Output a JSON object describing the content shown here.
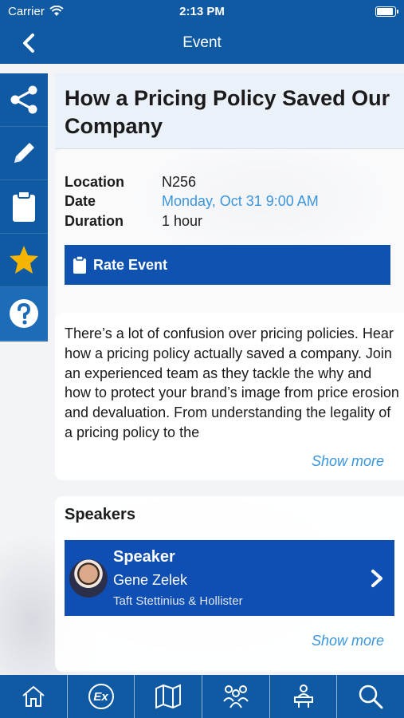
{
  "status_bar": {
    "carrier": "Carrier",
    "time": "2:13 PM"
  },
  "nav": {
    "title": "Event"
  },
  "rail": {
    "icons": [
      "share-icon",
      "pencil-icon",
      "clipboard-icon",
      "star-icon",
      "help-icon"
    ],
    "star_color": "#f5b400"
  },
  "event": {
    "title": "How a Pricing Policy Saved Our Company",
    "details": {
      "location_label": "Location",
      "location_value": "N256",
      "date_label": "Date",
      "date_value": "Monday, Oct 31 9:00 AM",
      "duration_label": "Duration",
      "duration_value": "1 hour"
    },
    "rate_label": "Rate Event",
    "description": "There’s a lot of confusion over pricing policies. Hear how a pricing policy actually saved a company. Join an experienced team as they tackle the why and how to protect your brand’s image from price erosion and devaluation. From understanding the legality of a pricing policy to the",
    "show_more": "Show more"
  },
  "speakers": {
    "title": "Speakers",
    "items": [
      {
        "role": "Speaker",
        "name": "Gene Zelek",
        "organization": "Taft Stettinius & Hollister"
      }
    ],
    "show_more": "Show more"
  },
  "tabbar": {
    "ex_label": "Ex",
    "icons": [
      "home-icon",
      "ex-icon",
      "map-icon",
      "people-icon",
      "speaker-podium-icon",
      "search-icon"
    ]
  },
  "colors": {
    "brand": "#0f5aa3",
    "button": "#0f52b0",
    "link": "#3b95dc"
  }
}
